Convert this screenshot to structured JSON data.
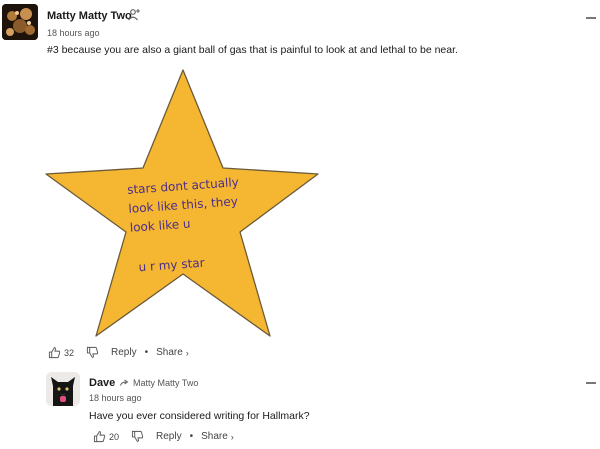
{
  "comments": [
    {
      "author": "Matty Matty Two",
      "time": "18 hours ago",
      "text": "#3 because you are also a giant ball of gas that is painful to look at and lethal to be near.",
      "meme": {
        "line1": "stars dont actually",
        "line2": "look like this, they",
        "line3": "look like u",
        "line4": "u r my star"
      },
      "likes": "32",
      "reply_label": "Reply",
      "share_label": "Share"
    },
    {
      "author": "Dave",
      "reply_to": "Matty Matty Two",
      "time": "18 hours ago",
      "text": "Have you ever considered writing for Hallmark?",
      "likes": "20",
      "reply_label": "Reply",
      "share_label": "Share"
    }
  ],
  "colors": {
    "star_fill": "#f5b731",
    "star_stroke": "#6b5a3a"
  },
  "icons": [
    "moderator-icon",
    "collapse-icon",
    "like-icon",
    "dislike-icon",
    "reply-arrow-icon",
    "chevron-right-icon"
  ]
}
